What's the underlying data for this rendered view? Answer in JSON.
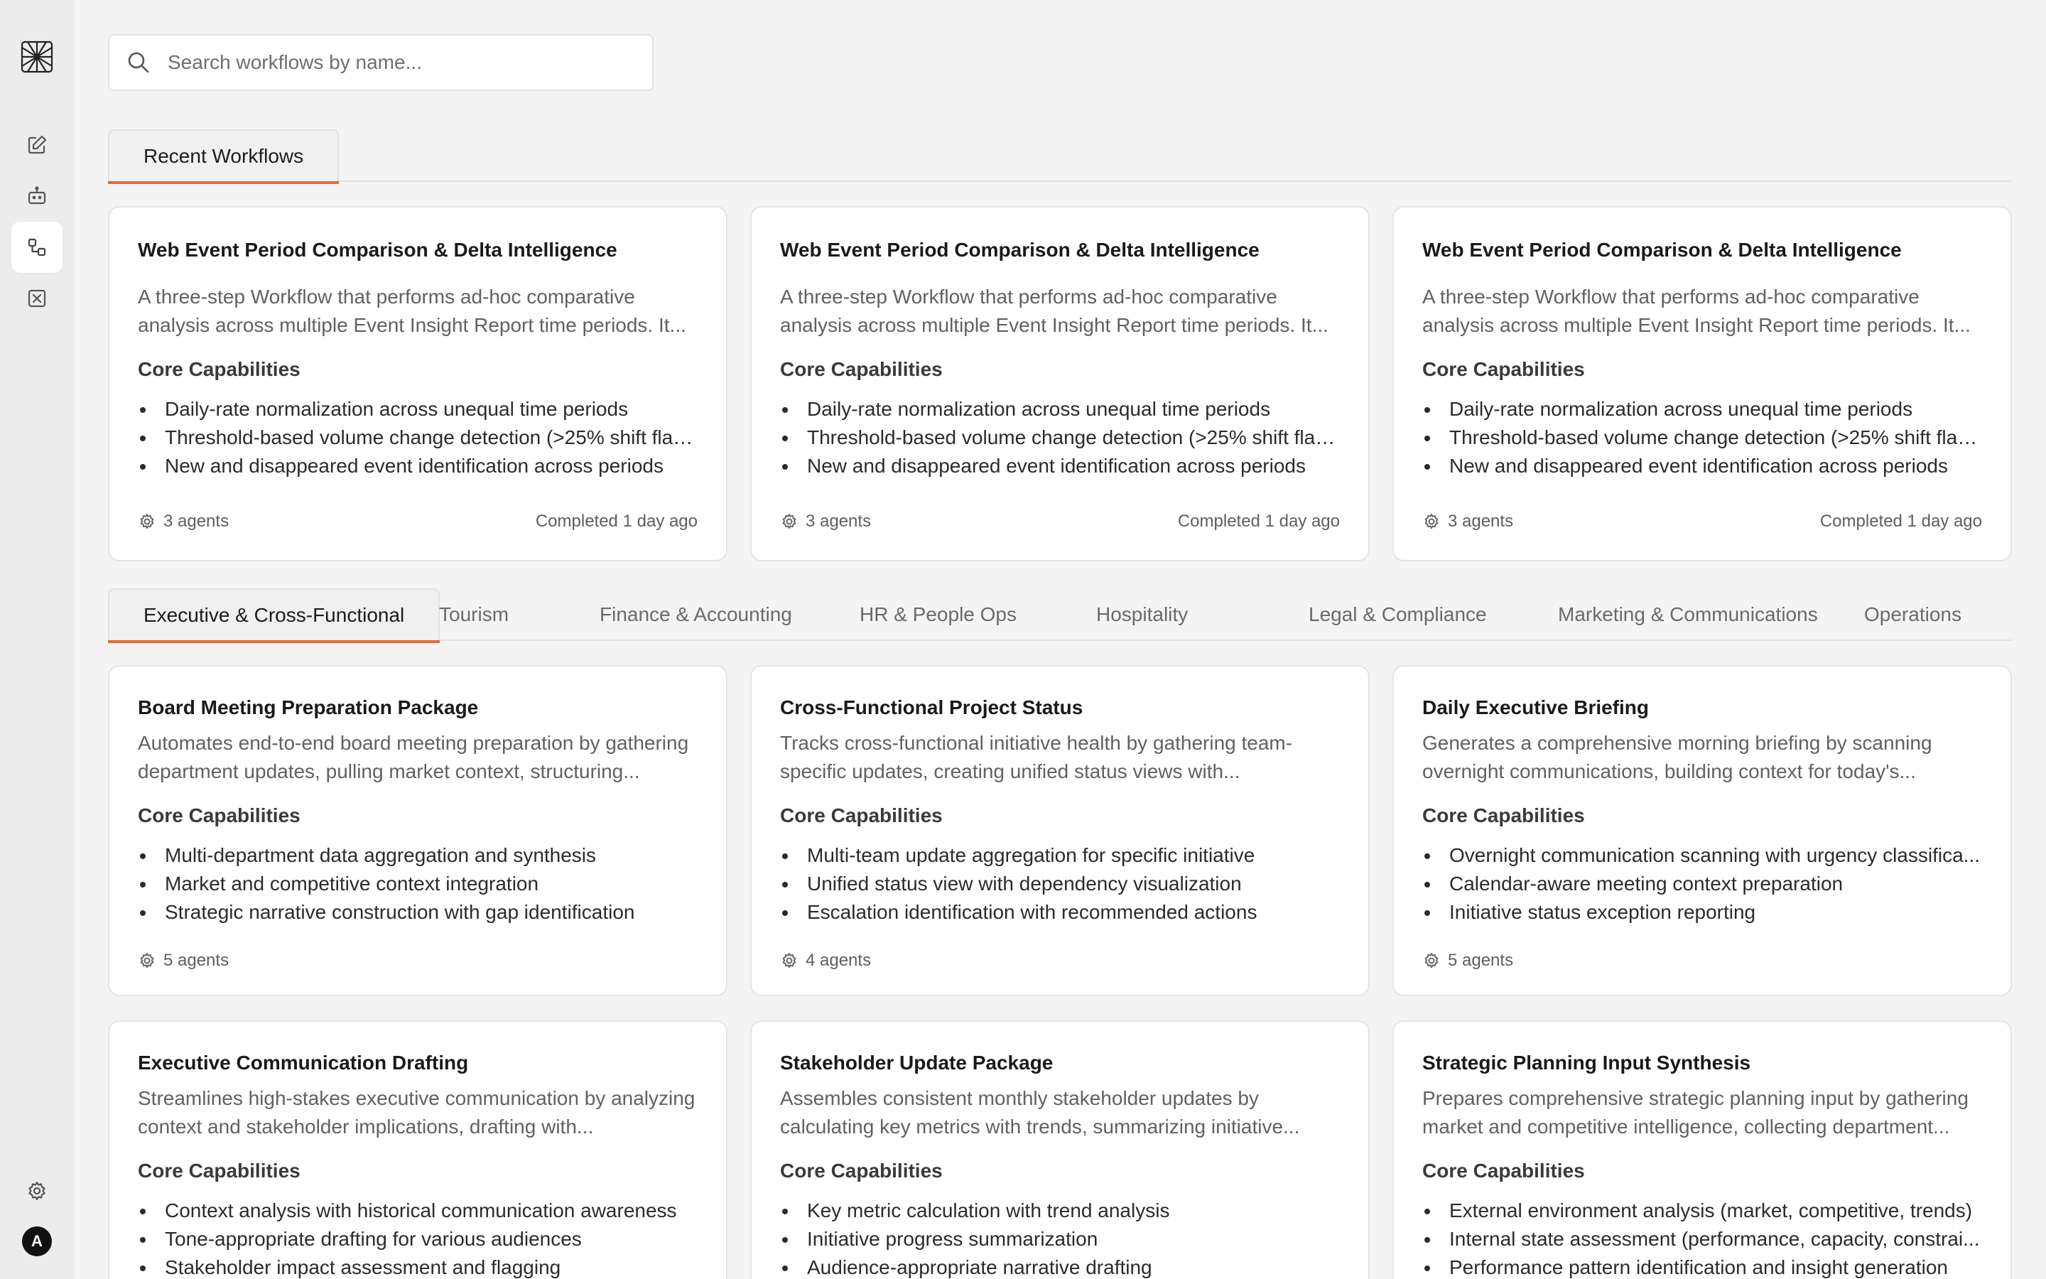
{
  "sidebar": {
    "icons": [
      "logo-icon",
      "edit-icon",
      "robot-icon",
      "workflow-icon",
      "close-box-icon",
      "settings-icon"
    ],
    "avatar_initial": "A"
  },
  "search": {
    "placeholder": "Search workflows by name..."
  },
  "recent_tabs": [
    {
      "label": "Recent Workflows",
      "active": true
    }
  ],
  "recent_cards": [
    {
      "title": "Web Event Period Comparison & Delta Intelligence",
      "description": "A three-step Workflow that performs ad-hoc comparative analysis across multiple Event Insight Report time periods. It...",
      "capabilities_heading": "Core Capabilities",
      "capabilities": [
        "Daily-rate normalization across unequal time periods",
        "Threshold-based volume change detection (>25% shift flag...",
        "New and disappeared event identification across periods"
      ],
      "agents": "3 agents",
      "status": "Completed 1 day ago"
    },
    {
      "title": "Web Event Period Comparison & Delta Intelligence",
      "description": "A three-step Workflow that performs ad-hoc comparative analysis across multiple Event Insight Report time periods. It...",
      "capabilities_heading": "Core Capabilities",
      "capabilities": [
        "Daily-rate normalization across unequal time periods",
        "Threshold-based volume change detection (>25% shift flag...",
        "New and disappeared event identification across periods"
      ],
      "agents": "3 agents",
      "status": "Completed 1 day ago"
    },
    {
      "title": "Web Event Period Comparison & Delta Intelligence",
      "description": "A three-step Workflow that performs ad-hoc comparative analysis across multiple Event Insight Report time periods. It...",
      "capabilities_heading": "Core Capabilities",
      "capabilities": [
        "Daily-rate normalization across unequal time periods",
        "Threshold-based volume change detection (>25% shift flag...",
        "New and disappeared event identification across periods"
      ],
      "agents": "3 agents",
      "status": "Completed 1 day ago"
    }
  ],
  "category_tabs": [
    {
      "label": "Executive & Cross-Functional",
      "active": true
    },
    {
      "label": "Tourism",
      "active": false
    },
    {
      "label": "Finance & Accounting",
      "active": false
    },
    {
      "label": "HR & People Ops",
      "active": false
    },
    {
      "label": "Hospitality",
      "active": false
    },
    {
      "label": "Legal & Compliance",
      "active": false
    },
    {
      "label": "Marketing & Communications",
      "active": false
    },
    {
      "label": "Operations",
      "active": false
    }
  ],
  "category_cards": [
    {
      "title": "Board Meeting Preparation Package",
      "description": "Automates end-to-end board meeting preparation by gathering department updates, pulling market context, structuring...",
      "capabilities_heading": "Core Capabilities",
      "capabilities": [
        "Multi-department data aggregation and synthesis",
        "Market and competitive context integration",
        "Strategic narrative construction with gap identification"
      ],
      "agents": "5 agents"
    },
    {
      "title": "Cross-Functional Project Status",
      "description": "Tracks cross-functional initiative health by gathering team-specific updates, creating unified status views with...",
      "capabilities_heading": "Core Capabilities",
      "capabilities": [
        "Multi-team update aggregation for specific initiative",
        "Unified status view with dependency visualization",
        "Escalation identification with recommended actions"
      ],
      "agents": "4 agents"
    },
    {
      "title": "Daily Executive Briefing",
      "description": "Generates a comprehensive morning briefing by scanning overnight communications, building context for today's...",
      "capabilities_heading": "Core Capabilities",
      "capabilities": [
        "Overnight communication scanning with urgency classifica...",
        "Calendar-aware meeting context preparation",
        "Initiative status exception reporting"
      ],
      "agents": "5 agents"
    },
    {
      "title": "Executive Communication Drafting",
      "description": "Streamlines high-stakes executive communication by analyzing context and stakeholder implications, drafting with...",
      "capabilities_heading": "Core Capabilities",
      "capabilities": [
        "Context analysis with historical communication awareness",
        "Tone-appropriate drafting for various audiences",
        "Stakeholder impact assessment and flagging"
      ],
      "agents": ""
    },
    {
      "title": "Stakeholder Update Package",
      "description": "Assembles consistent monthly stakeholder updates by calculating key metrics with trends, summarizing initiative...",
      "capabilities_heading": "Core Capabilities",
      "capabilities": [
        "Key metric calculation with trend analysis",
        "Initiative progress summarization",
        "Audience-appropriate narrative drafting"
      ],
      "agents": ""
    },
    {
      "title": "Strategic Planning Input Synthesis",
      "description": "Prepares comprehensive strategic planning input by gathering market and competitive intelligence, collecting department...",
      "capabilities_heading": "Core Capabilities",
      "capabilities": [
        "External environment analysis (market, competitive, trends)",
        "Internal state assessment (performance, capacity, constrai...",
        "Performance pattern identification and insight generation"
      ],
      "agents": ""
    }
  ]
}
